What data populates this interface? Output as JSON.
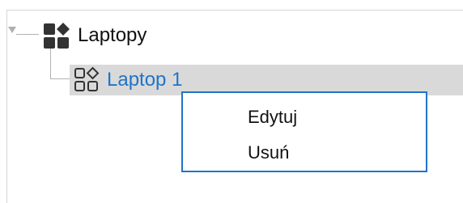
{
  "tree": {
    "parent": {
      "label": "Laptopy",
      "icon": "category-filled-icon"
    },
    "child": {
      "label": "Laptop 1",
      "icon": "category-outline-icon",
      "selected": true
    }
  },
  "context_menu": {
    "items": [
      {
        "label": "Edytuj"
      },
      {
        "label": "Usuń"
      }
    ]
  },
  "colors": {
    "accent": "#1f74c9",
    "selection_background": "#d9d9d9",
    "icon_dark": "#333333"
  }
}
